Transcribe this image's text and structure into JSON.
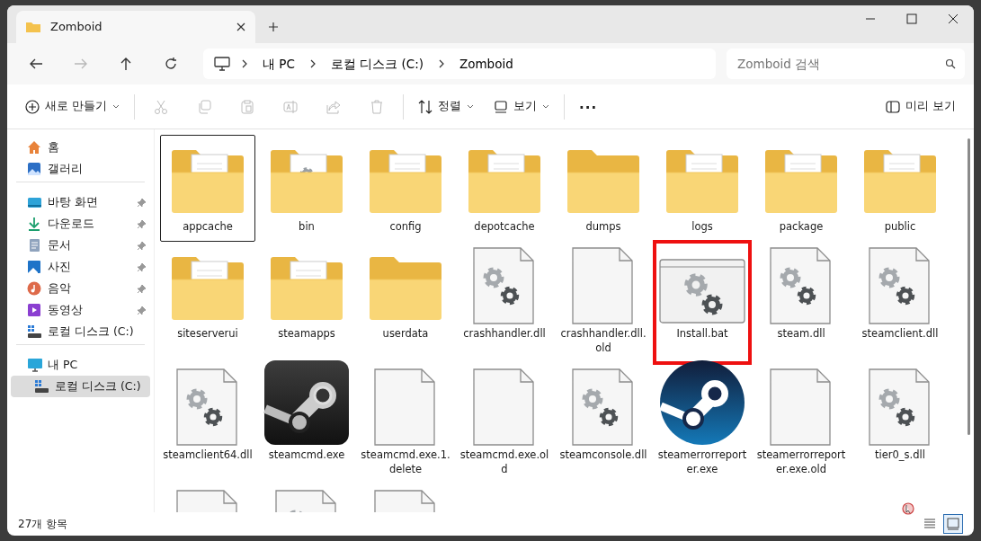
{
  "window": {
    "tab_title": "Zomboid"
  },
  "address": {
    "segments": [
      "내 PC",
      "로컬 디스크 (C:)",
      "Zomboid"
    ]
  },
  "nav_buttons": [
    {
      "kind": "back",
      "disabled": false
    },
    {
      "kind": "forward",
      "disabled": true
    },
    {
      "kind": "up",
      "disabled": false
    },
    {
      "kind": "refresh",
      "disabled": false
    }
  ],
  "search": {
    "placeholder": "Zomboid 검색"
  },
  "toolbar": [
    {
      "kind": "new",
      "label": "새로 만들기",
      "dropdown": true,
      "disabled": false
    },
    {
      "kind": "cut",
      "disabled": true
    },
    {
      "kind": "copy",
      "disabled": true
    },
    {
      "kind": "paste",
      "disabled": true
    },
    {
      "kind": "rename",
      "disabled": true
    },
    {
      "kind": "share",
      "disabled": true
    },
    {
      "kind": "delete",
      "disabled": true
    },
    {
      "kind": "sort",
      "label": "정렬",
      "dropdown": true,
      "disabled": false
    },
    {
      "kind": "view",
      "label": "보기",
      "dropdown": true,
      "disabled": false
    },
    {
      "kind": "more",
      "label": "...",
      "disabled": false
    }
  ],
  "preview_button": {
    "label": "미리 보기"
  },
  "sidebar": {
    "sections": [
      {
        "items": [
          {
            "kind": "home",
            "label": "홈",
            "pinned": false,
            "selected": false
          },
          {
            "kind": "gallery",
            "label": "갤러리",
            "pinned": false,
            "selected": false
          }
        ]
      },
      {
        "items": [
          {
            "kind": "desktop",
            "label": "바탕 화면",
            "pinned": true,
            "selected": false
          },
          {
            "kind": "download",
            "label": "다운로드",
            "pinned": true,
            "selected": false
          },
          {
            "kind": "documents",
            "label": "문서",
            "pinned": true,
            "selected": false
          },
          {
            "kind": "pictures",
            "label": "사진",
            "pinned": true,
            "selected": false
          },
          {
            "kind": "music",
            "label": "음악",
            "pinned": true,
            "selected": false
          },
          {
            "kind": "videos",
            "label": "동영상",
            "pinned": true,
            "selected": false
          },
          {
            "kind": "drive",
            "label": "로컬 디스크 (C:)",
            "pinned": false,
            "selected": false
          }
        ]
      },
      {
        "items": [
          {
            "kind": "pc",
            "label": "내 PC",
            "pinned": false,
            "selected": false,
            "children": [
              {
                "kind": "drive",
                "label": "로컬 디스크 (C:)",
                "pinned": false,
                "selected": true
              }
            ]
          }
        ]
      }
    ]
  },
  "files": [
    {
      "kind": "page-folder",
      "label": "appcache",
      "selected": true,
      "annotated": false
    },
    {
      "kind": "gear-folder",
      "label": "bin",
      "selected": false,
      "annotated": false
    },
    {
      "kind": "page-folder",
      "label": "config",
      "selected": false,
      "annotated": false
    },
    {
      "kind": "page-folder",
      "label": "depotcache",
      "selected": false,
      "annotated": false
    },
    {
      "kind": "folder",
      "label": "dumps",
      "selected": false,
      "annotated": false
    },
    {
      "kind": "page-folder",
      "label": "logs",
      "selected": false,
      "annotated": false
    },
    {
      "kind": "page-folder",
      "label": "package",
      "selected": false,
      "annotated": false
    },
    {
      "kind": "page-folder",
      "label": "public",
      "selected": false,
      "annotated": false
    },
    {
      "kind": "page-folder",
      "label": "siteserverui",
      "selected": false,
      "annotated": false
    },
    {
      "kind": "page-folder",
      "label": "steamapps",
      "selected": false,
      "annotated": false
    },
    {
      "kind": "folder",
      "label": "userdata",
      "selected": false,
      "annotated": false
    },
    {
      "kind": "gear-file",
      "label": "crashhandler.dll",
      "selected": false,
      "annotated": false
    },
    {
      "kind": "blank-file",
      "label": "crashhandler.dll.old",
      "selected": false,
      "annotated": false
    },
    {
      "kind": "batch-file",
      "label": "Install.bat",
      "selected": false,
      "annotated": true
    },
    {
      "kind": "gear-file",
      "label": "steam.dll",
      "selected": false,
      "annotated": false
    },
    {
      "kind": "gear-file",
      "label": "steamclient.dll",
      "selected": false,
      "annotated": false
    },
    {
      "kind": "gear-file",
      "label": "steamclient64.dll",
      "selected": false,
      "annotated": false
    },
    {
      "kind": "steam-dark",
      "label": "steamcmd.exe",
      "selected": false,
      "annotated": false
    },
    {
      "kind": "blank-file",
      "label": "steamcmd.exe.1.delete",
      "selected": false,
      "annotated": false
    },
    {
      "kind": "blank-file",
      "label": "steamcmd.exe.old",
      "selected": false,
      "annotated": false
    },
    {
      "kind": "gear-file",
      "label": "steamconsole.dll",
      "selected": false,
      "annotated": false
    },
    {
      "kind": "steam-blue",
      "label": "steamerrorreporter.exe",
      "selected": false,
      "annotated": false
    },
    {
      "kind": "blank-file",
      "label": "steamerrorreporter.exe.old",
      "selected": false,
      "annotated": false
    },
    {
      "kind": "gear-file",
      "label": "tier0_s.dll",
      "selected": false,
      "annotated": false
    },
    {
      "kind": "blank-file",
      "selected": false,
      "annotated": false
    },
    {
      "kind": "gear-file",
      "selected": false,
      "annotated": false
    },
    {
      "kind": "blank-file",
      "selected": false,
      "annotated": false
    }
  ],
  "status_bar": {
    "count": "27개 항목",
    "view_modes": [
      {
        "kind": "details",
        "selected": false
      },
      {
        "kind": "large-icons",
        "selected": true
      }
    ]
  }
}
